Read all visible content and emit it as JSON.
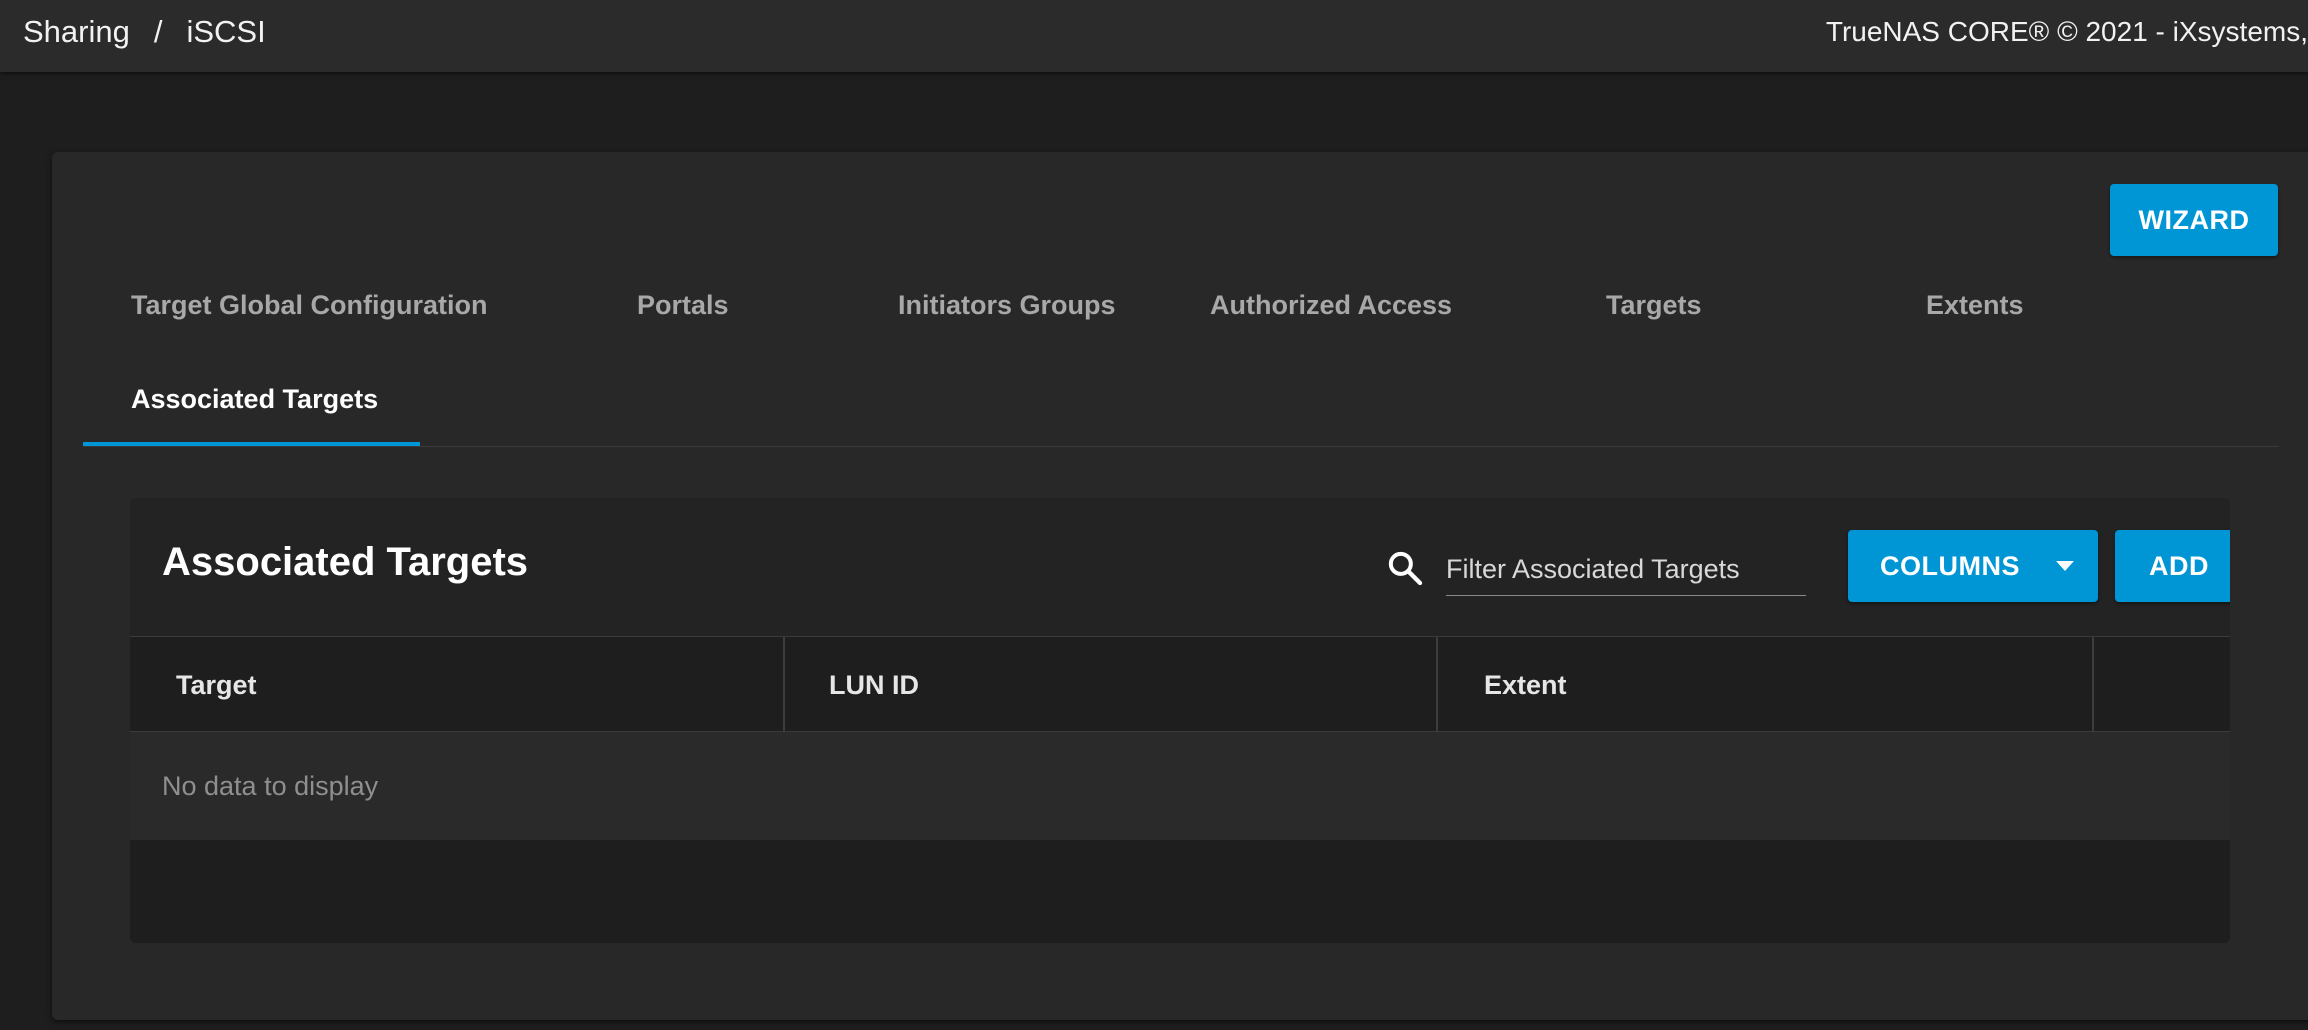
{
  "header": {
    "breadcrumb": [
      "Sharing",
      "iSCSI"
    ],
    "breadcrumb_separator": "/",
    "copyright": "TrueNAS CORE® © 2021 - iXsystems,"
  },
  "toolbar": {
    "wizard_label": "WIZARD"
  },
  "tabs": [
    {
      "label": "Target Global Configuration",
      "active": false
    },
    {
      "label": "Portals",
      "active": false
    },
    {
      "label": "Initiators Groups",
      "active": false
    },
    {
      "label": "Authorized Access",
      "active": false
    },
    {
      "label": "Targets",
      "active": false
    },
    {
      "label": "Extents",
      "active": false
    },
    {
      "label": "Associated Targets",
      "active": true
    }
  ],
  "table": {
    "title": "Associated Targets",
    "search_icon": "search-icon",
    "filter_placeholder": "Filter Associated Targets",
    "columns_label": "COLUMNS",
    "add_label": "ADD",
    "columns": [
      "Target",
      "LUN ID",
      "Extent"
    ],
    "empty_message": "No data to display"
  },
  "colors": {
    "accent": "#0095d5",
    "background": "#1e1e1e",
    "card": "#282828"
  }
}
